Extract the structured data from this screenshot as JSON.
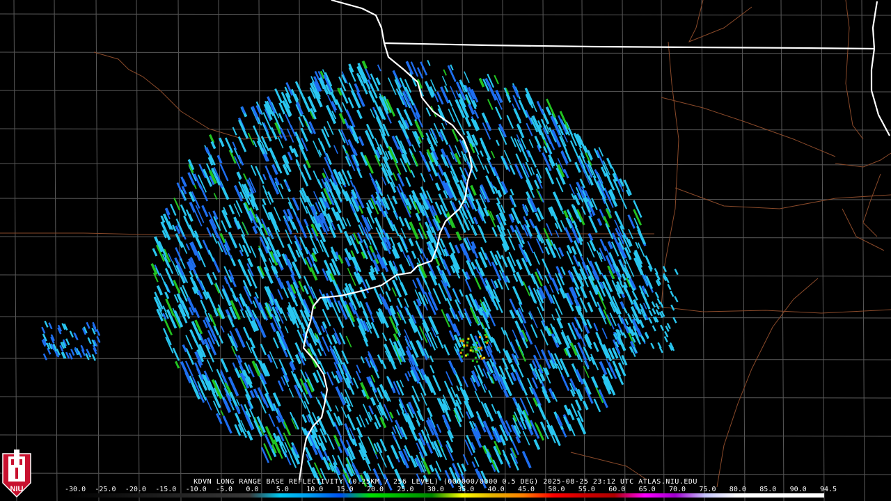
{
  "product": {
    "title": "KDVN LONG RANGE BASE REFLECTIVITY (0.25KM / 256 LEVEL) (000000/0000 0.5 DEG) 2025-08-25 23:12 UTC  ATLAS.NIU.EDU",
    "logo_text": "NIU"
  },
  "colorbar": {
    "labels": [
      "-30.0",
      "-25.0",
      "-20.0",
      "-15.0",
      "-10.0",
      "-5.0",
      "0.0",
      "5.0",
      "10.0",
      "15.0",
      "20.0",
      "25.0",
      "30.0",
      "35.0",
      "40.0",
      "45.0",
      "50.0",
      "55.0",
      "60.0",
      "65.0",
      "70.0",
      "75.0",
      "80.0",
      "85.0",
      "90.0",
      "94.5"
    ],
    "stops": [
      {
        "dbz": -30,
        "color": "#000000"
      },
      {
        "dbz": 0,
        "color": "#3a3a3a"
      },
      {
        "dbz": 5,
        "color": "#00c8f0"
      },
      {
        "dbz": 10,
        "color": "#009cf0"
      },
      {
        "dbz": 15,
        "color": "#0050f0"
      },
      {
        "dbz": 20,
        "color": "#00e000"
      },
      {
        "dbz": 25,
        "color": "#00b400"
      },
      {
        "dbz": 30,
        "color": "#008800"
      },
      {
        "dbz": 35,
        "color": "#ffff00"
      },
      {
        "dbz": 40,
        "color": "#e6b400"
      },
      {
        "dbz": 45,
        "color": "#ff8000"
      },
      {
        "dbz": 50,
        "color": "#ff0000"
      },
      {
        "dbz": 55,
        "color": "#d00000"
      },
      {
        "dbz": 60,
        "color": "#b00000"
      },
      {
        "dbz": 65,
        "color": "#ff00ff"
      },
      {
        "dbz": 70,
        "color": "#a000d0"
      },
      {
        "dbz": 75,
        "color": "#c8c8ff"
      },
      {
        "dbz": 80,
        "color": "#ffffff"
      },
      {
        "dbz": 94.5,
        "color": "#ffffff"
      }
    ]
  },
  "colors": {
    "background": "#000000",
    "county_lines": "#5a5a5a",
    "state_lines": "#ffffff",
    "highways": "#8a4a2a",
    "echo_light": "#29c6f0",
    "echo_medium": "#1e6ef0",
    "echo_green": "#22c422",
    "echo_yellow": "#f0e000",
    "echo_orange": "#e89000"
  }
}
